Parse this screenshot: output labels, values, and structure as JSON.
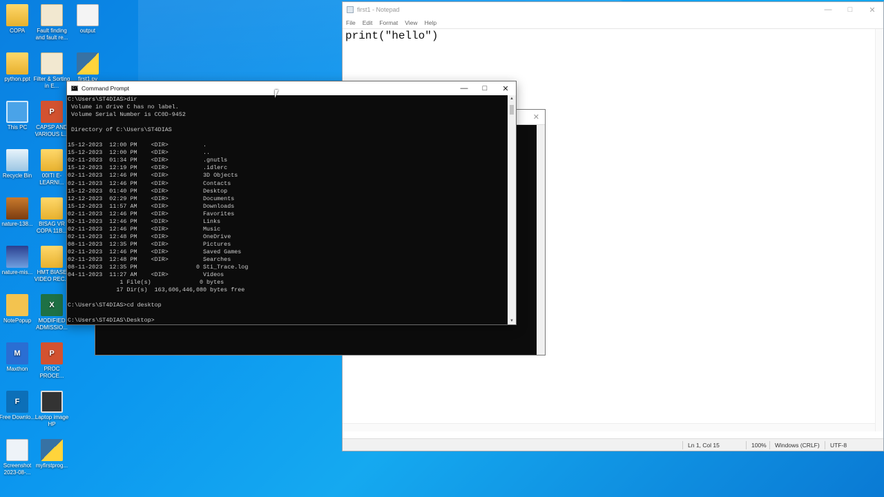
{
  "desktop": {
    "icons": [
      {
        "label": "COPA",
        "glyph": "",
        "kind": "g-folder"
      },
      {
        "label": "Fault finding and fault re...",
        "glyph": "",
        "kind": "g-pdf"
      },
      {
        "label": "output",
        "glyph": "",
        "kind": "g-file"
      },
      {
        "label": "python.ppt",
        "glyph": "",
        "kind": "g-folder"
      },
      {
        "label": "Filter & Sorting in E...",
        "glyph": "",
        "kind": "g-pdf"
      },
      {
        "label": "first1.py",
        "glyph": "",
        "kind": "g-py"
      },
      {
        "label": "This PC",
        "glyph": "",
        "kind": "g-pc"
      },
      {
        "label": "CAPSP AND VARIOUS L...",
        "glyph": "P",
        "kind": "g-ppt"
      },
      {
        "label": "Recycle Bin",
        "glyph": "",
        "kind": "g-bin"
      },
      {
        "label": "00ITI E-LEARNI...",
        "glyph": "",
        "kind": "g-folder"
      },
      {
        "label": "nature-138...",
        "glyph": "",
        "kind": "g-img"
      },
      {
        "label": "BISAG VR COPA 11B...",
        "glyph": "",
        "kind": "g-folder"
      },
      {
        "label": "nature-mis...",
        "glyph": "",
        "kind": "g-img2"
      },
      {
        "label": "HMT BIASE VIDEO REC...",
        "glyph": "",
        "kind": "g-folder"
      },
      {
        "label": "NotePopup",
        "glyph": "",
        "kind": "g-note"
      },
      {
        "label": "MODIFIED ADMISSIO...",
        "glyph": "X",
        "kind": "g-xls"
      },
      {
        "label": "Maxthon",
        "glyph": "M",
        "kind": "g-max"
      },
      {
        "label": "PROC PROCE...",
        "glyph": "P",
        "kind": "g-ppt"
      },
      {
        "label": "Free Downlo...",
        "glyph": "F",
        "kind": "g-free"
      },
      {
        "label": "Laptop image HP",
        "glyph": "",
        "kind": "g-laptop"
      },
      {
        "label": "Screenshot 2023-08-...",
        "glyph": "",
        "kind": "g-shot"
      },
      {
        "label": "myfirstprog...",
        "glyph": "",
        "kind": "g-py"
      }
    ]
  },
  "notepad": {
    "title": "first1 - Notepad",
    "menu": [
      "File",
      "Edit",
      "Format",
      "View",
      "Help"
    ],
    "content": "print(\"hello\")",
    "status": {
      "position": "Ln 1, Col 15",
      "zoom": "100%",
      "line_ending": "Windows (CRLF)",
      "encoding": "UTF-8"
    }
  },
  "cmd": {
    "title": "Command Prompt",
    "lines": [
      "C:\\Users\\ST4DIAS>dir",
      " Volume in drive C has no label.",
      " Volume Serial Number is CC0D-9452",
      "",
      " Directory of C:\\Users\\ST4DIAS",
      "",
      "15-12-2023  12:00 PM    <DIR>          .",
      "15-12-2023  12:00 PM    <DIR>          ..",
      "02-11-2023  01:34 PM    <DIR>          .gnutls",
      "15-12-2023  12:19 PM    <DIR>          .idlerc",
      "02-11-2023  12:46 PM    <DIR>          3D Objects",
      "02-11-2023  12:46 PM    <DIR>          Contacts",
      "15-12-2023  01:40 PM    <DIR>          Desktop",
      "12-12-2023  02:29 PM    <DIR>          Documents",
      "15-12-2023  11:57 AM    <DIR>          Downloads",
      "02-11-2023  12:46 PM    <DIR>          Favorites",
      "02-11-2023  12:46 PM    <DIR>          Links",
      "02-11-2023  12:46 PM    <DIR>          Music",
      "02-11-2023  12:48 PM    <DIR>          OneDrive",
      "08-11-2023  12:35 PM    <DIR>          Pictures",
      "02-11-2023  12:46 PM    <DIR>          Saved Games",
      "02-11-2023  12:48 PM    <DIR>          Searches",
      "08-11-2023  12:35 PM                 0 Sti_Trace.log",
      "04-11-2023  11:27 AM    <DIR>          Videos",
      "               1 File(s)              0 bytes",
      "              17 Dir(s)  163,606,446,080 bytes free",
      "",
      "C:\\Users\\ST4DIAS>cd desktop",
      "",
      "C:\\Users\\ST4DIAS\\Desktop>"
    ]
  },
  "icons": {
    "minimize": "minimize-icon",
    "maximize": "maximize-icon",
    "close": "close-icon"
  },
  "colors": {
    "desktop_blue": "#0b96ef",
    "console_bg": "#0c0c0c",
    "console_text": "#cccccc"
  }
}
